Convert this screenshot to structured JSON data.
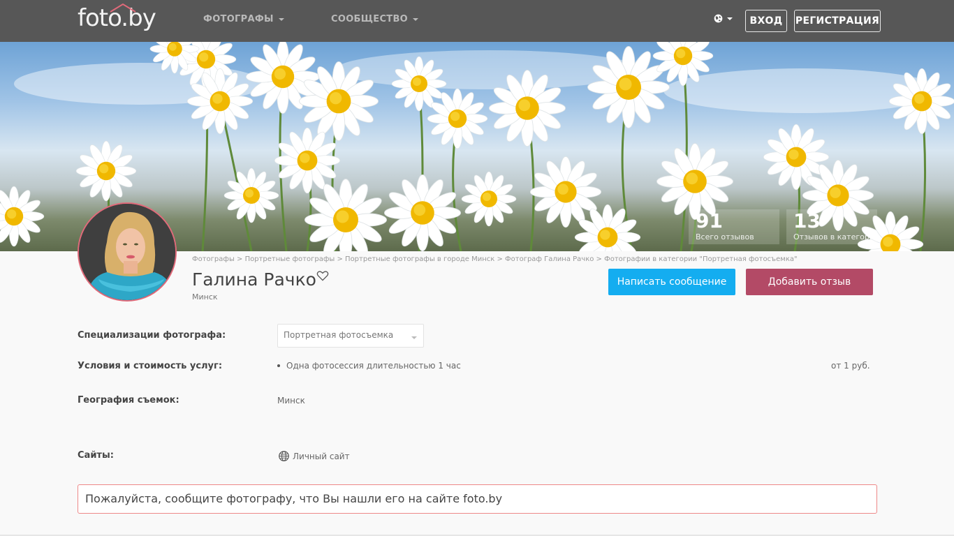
{
  "header": {
    "logo_text": "foto.by",
    "nav": [
      {
        "label": "ФОТОГРАФЫ"
      },
      {
        "label": "СООБЩЕСТВО"
      }
    ],
    "login_label": "ВХОД",
    "register_label": "РЕГИСТРАЦИЯ"
  },
  "stats": [
    {
      "value": "91",
      "label": "Всего отзывов"
    },
    {
      "value": "13",
      "label": "Отзывов в категории"
    }
  ],
  "breadcrumb": [
    "Фотографы",
    "Портретные фотографы",
    "Портретные фотографы в городе Минск",
    "Фотограф Галина Рачко",
    "Фотографии в категории \"Портретная фотосъемка\""
  ],
  "breadcrumb_sep": " > ",
  "profile": {
    "name": "Галина Рачко",
    "city": "Минск",
    "message_button": "Написать сообщение",
    "review_button": "Добавить отзыв"
  },
  "info": {
    "specialization_label": "Специализации фотографа:",
    "specialization_value": "Портретная фотосъемка",
    "services_label": "Условия и стоимость услуг:",
    "service_item": "Одна фотосессия длительностью 1 час",
    "service_price": "от 1 руб.",
    "geo_label": "География съемок:",
    "geo_value": "Минск",
    "sites_label": "Сайты:",
    "site_link": "Личный сайт"
  },
  "notice": "Пожалуйста, сообщите фотографу, что Вы нашли его на сайте foto.by",
  "colors": {
    "topbar": "#575757",
    "message_button": "#14adf0",
    "review_button": "#b34a66",
    "notice_border": "#ee8888"
  },
  "icons": [
    "globe-icon",
    "heart-icon",
    "caret-down-icon"
  ]
}
